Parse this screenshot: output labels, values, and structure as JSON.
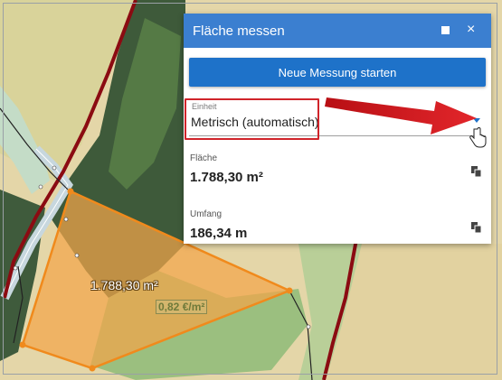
{
  "map": {
    "area_label": "1.788,30 m²",
    "price_label": "0,82 €/m²"
  },
  "panel": {
    "title": "Fläche messen",
    "maximize_icon": "maximize-icon",
    "close_label": "×",
    "new_measurement_button": "Neue Messung starten",
    "unit": {
      "label": "Einheit",
      "value": "Metrisch (automatisch)"
    },
    "area": {
      "label": "Fläche",
      "value": "1.788,30 m²"
    },
    "perimeter": {
      "label": "Umfang",
      "value": "186,34 m"
    }
  },
  "colors": {
    "header": "#3b7fd0",
    "button": "#1e72c9",
    "highlight": "#d0242a",
    "polygon_fill": "#f2a54a",
    "polygon_stroke": "#f08a1c"
  }
}
